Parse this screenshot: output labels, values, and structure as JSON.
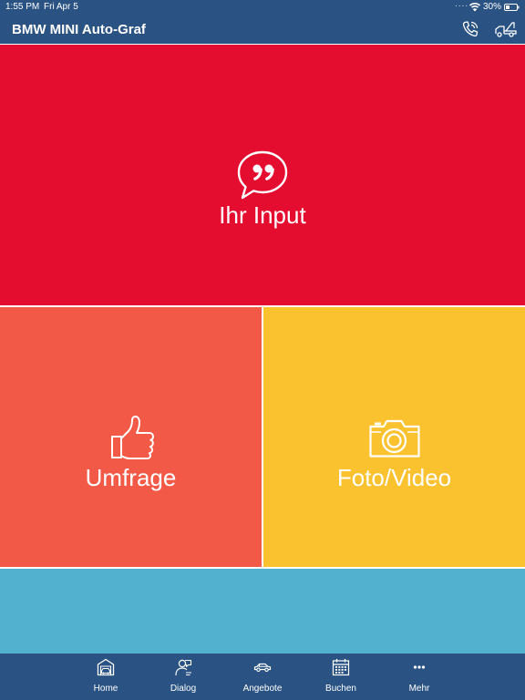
{
  "status_bar": {
    "time": "1:55 PM",
    "date": "Fri Apr 5",
    "signal_dots": "....",
    "battery": "30%"
  },
  "header": {
    "title": "BMW MINI Auto-Graf",
    "icons": [
      "phone-icon",
      "tow-truck-icon"
    ],
    "background": "#2a5383"
  },
  "tiles": {
    "input": {
      "label": "Ihr Input",
      "icon": "speech-bubble-quote-icon",
      "color": "#e40d2f"
    },
    "umfrage": {
      "label": "Umfrage",
      "icon": "thumbs-up-icon",
      "color": "#f25a47"
    },
    "foto": {
      "label": "Foto/Video",
      "icon": "camera-icon",
      "color": "#fbc230"
    },
    "blue": {
      "color": "#51b1cf"
    }
  },
  "tabs": [
    {
      "label": "Home",
      "icon": "garage-icon"
    },
    {
      "label": "Dialog",
      "icon": "person-chat-icon"
    },
    {
      "label": "Angebote",
      "icon": "car-icon"
    },
    {
      "label": "Buchen",
      "icon": "calendar-icon"
    },
    {
      "label": "Mehr",
      "icon": "more-dots-icon"
    }
  ]
}
